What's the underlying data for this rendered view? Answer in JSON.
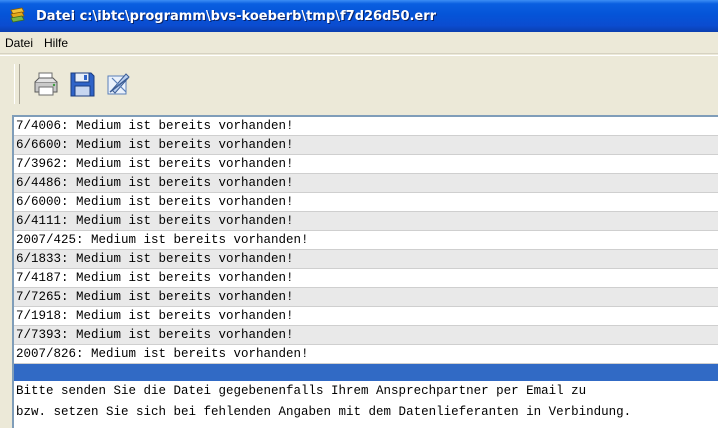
{
  "window": {
    "title": "Datei c:\\ibtc\\programm\\bvs-koeberb\\tmp\\f7d26d50.err",
    "icon": "app-icon"
  },
  "menu": {
    "items": [
      {
        "label": "Datei"
      },
      {
        "label": "Hilfe"
      }
    ]
  },
  "toolbar": {
    "buttons": [
      {
        "icon": "printer-icon"
      },
      {
        "icon": "save-disk-icon"
      },
      {
        "icon": "edit-delete-icon"
      }
    ]
  },
  "log": {
    "rows": [
      {
        "text": "7/4006: Medium ist bereits vorhanden!"
      },
      {
        "text": "6/6600: Medium ist bereits vorhanden!"
      },
      {
        "text": "7/3962: Medium ist bereits vorhanden!"
      },
      {
        "text": "6/4486: Medium ist bereits vorhanden!"
      },
      {
        "text": "6/6000: Medium ist bereits vorhanden!"
      },
      {
        "text": "6/4111: Medium ist bereits vorhanden!"
      },
      {
        "text": "2007/425: Medium ist bereits vorhanden!"
      },
      {
        "text": "6/1833: Medium ist bereits vorhanden!"
      },
      {
        "text": "7/4187: Medium ist bereits vorhanden!"
      },
      {
        "text": "7/7265: Medium ist bereits vorhanden!"
      },
      {
        "text": "7/1918: Medium ist bereits vorhanden!"
      },
      {
        "text": "7/7393: Medium ist bereits vorhanden!"
      },
      {
        "text": "2007/826: Medium ist bereits vorhanden!"
      }
    ],
    "info": [
      "Bitte senden Sie die Datei gegebenenfalls Ihrem Ansprechpartner per Email zu",
      "bzw. setzen Sie sich bei fehlenden Angaben mit dem Datenlieferanten in Verbindung."
    ]
  },
  "colors": {
    "titlebar": "#0554d8",
    "selection": "#316ac5",
    "background": "#ece9d8"
  }
}
